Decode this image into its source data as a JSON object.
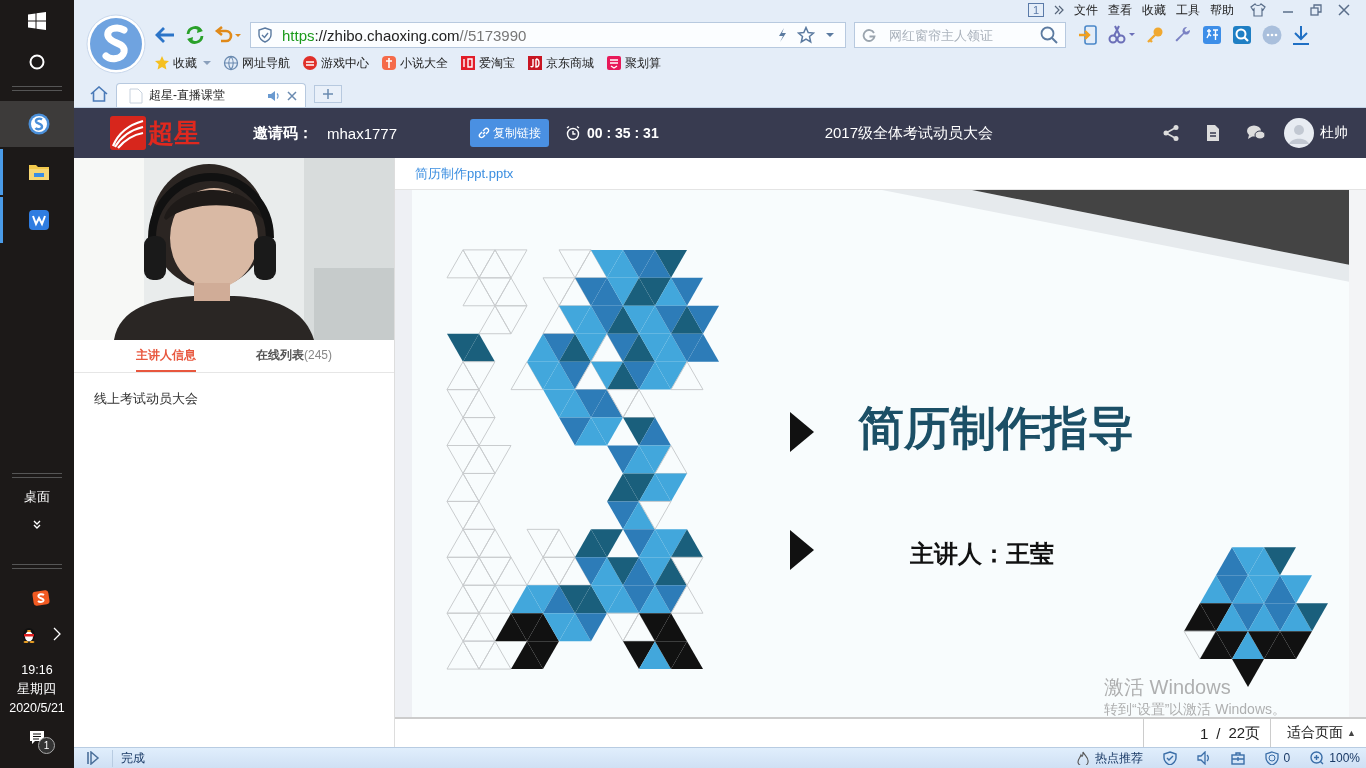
{
  "taskbar": {
    "apps": [
      {
        "kind": "browser",
        "selected": true
      },
      {
        "kind": "folder",
        "selected": false
      },
      {
        "kind": "wps",
        "selected": false
      }
    ],
    "desktop_label": "桌面",
    "clock": {
      "time": "19:16",
      "weekday": "星期四",
      "date": "2020/5/21"
    },
    "notification_count": "1"
  },
  "browser": {
    "window_count": "1",
    "menu": [
      "文件",
      "查看",
      "收藏",
      "工具",
      "帮助"
    ],
    "address": {
      "scheme": "https",
      "host": "://zhibo.chaoxing.com",
      "path": "//5173990"
    },
    "search": {
      "placeholder": "网红窗帘主人领证"
    },
    "bookmarks": [
      {
        "kind": "star",
        "label": "收藏"
      },
      {
        "kind": "globe",
        "label": "网址导航"
      },
      {
        "kind": "game",
        "label": "游戏中心"
      },
      {
        "kind": "novel",
        "label": "小说大全"
      },
      {
        "kind": "taobao",
        "label": "爱淘宝"
      },
      {
        "kind": "jd",
        "label": "京东商城"
      },
      {
        "kind": "juhuasuan",
        "label": "聚划算"
      }
    ],
    "tabs": [
      {
        "title": "超星-直播课堂",
        "selected": true
      }
    ],
    "status": "完成",
    "status_items": [
      {
        "kind": "flame",
        "label": "热点推荐"
      },
      {
        "kind": "shield"
      },
      {
        "kind": "speaker"
      },
      {
        "kind": "toolbox"
      },
      {
        "kind": "adblock",
        "label": "0"
      },
      {
        "kind": "zoom",
        "label": "100%"
      }
    ]
  },
  "header": {
    "logo": "超星",
    "invite_label": "邀请码：",
    "invite_code": "mhax1777",
    "copy_button": "复制链接",
    "timer": "00 : 35 : 31",
    "title": "2017级全体考试动员大会",
    "user": "杜帅"
  },
  "panel_tabs": [
    {
      "label": "主讲人信息",
      "selected": true
    },
    {
      "label": "在线列表",
      "count": "(245)",
      "selected": false
    }
  ],
  "description": "线上考试动员大会",
  "document": {
    "file_tab": "简历制作ppt.pptx",
    "slide": {
      "title": "简历制作指导",
      "speaker": "主讲人：王莹"
    },
    "pager": {
      "current": "1",
      "separator": "/",
      "total": "22页"
    },
    "fit": {
      "label": "适合页面",
      "caret": "▲"
    }
  },
  "os_watermark": {
    "title": "激活 Windows",
    "subtitle": "转到“设置”以激活 Windows。"
  }
}
